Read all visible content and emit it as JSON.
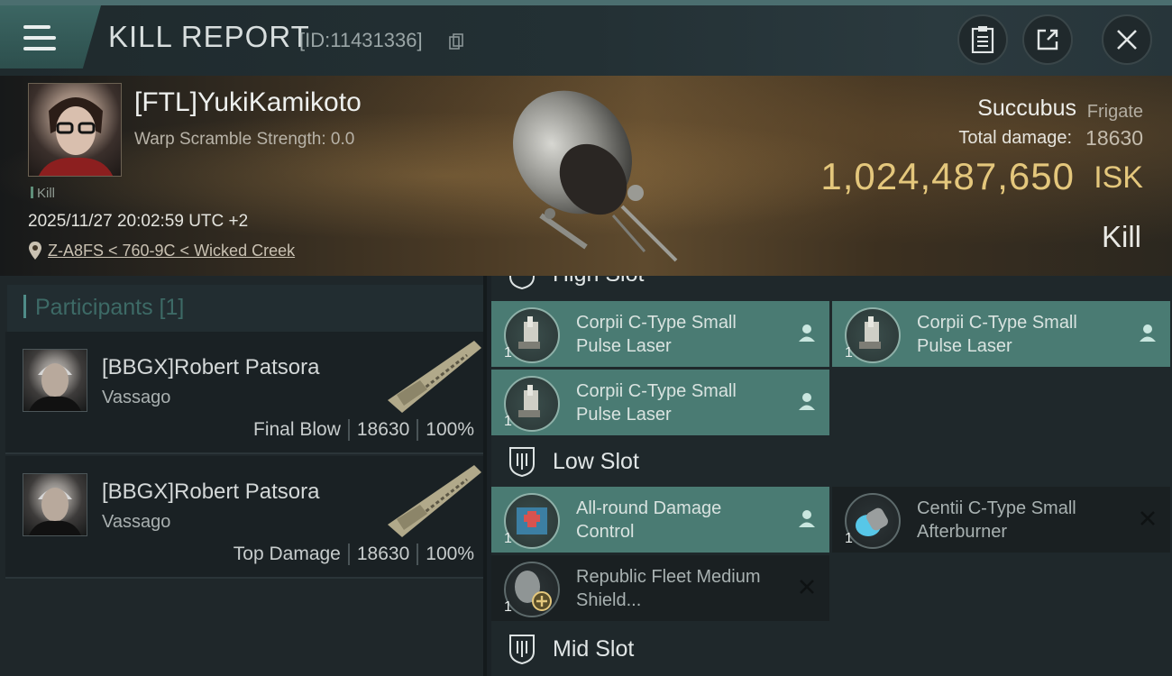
{
  "header": {
    "title": "KILL REPORT",
    "report_id": "[ID:11431336]"
  },
  "victim": {
    "pilot_name": "[FTL]YukiKamikoto",
    "warp_scramble": "Warp Scramble Strength: 0.0",
    "tag": "Kill",
    "datetime": "2025/11/27 20:02:59 UTC +2",
    "location": "Z-A8FS < 760-9C < Wicked Creek",
    "ship_name": "Succubus",
    "ship_class": "Frigate",
    "total_damage_label": "Total damage:",
    "total_damage": "18630",
    "isk_value": "1,024,487,650",
    "isk_unit": "ISK",
    "result": "Kill"
  },
  "participants": {
    "title": "Participants [1]",
    "rows": [
      {
        "name": "[BBGX]Robert Patsora",
        "ship": "Vassago",
        "label": "Final Blow",
        "damage": "18630",
        "percent": "100%"
      },
      {
        "name": "[BBGX]Robert Patsora",
        "ship": "Vassago",
        "label": "Top Damage",
        "damage": "18630",
        "percent": "100%"
      }
    ]
  },
  "slots": {
    "high_label": "High Slot",
    "low_label": "Low Slot",
    "mid_label": "Mid Slot",
    "high": [
      {
        "qty": "1",
        "name": "Corpii C-Type Small Pulse Laser",
        "state": "dropped"
      },
      {
        "qty": "1",
        "name": "Corpii C-Type Small Pulse Laser",
        "state": "dropped"
      },
      {
        "qty": "1",
        "name": "Corpii C-Type Small Pulse Laser",
        "state": "dropped"
      }
    ],
    "low": [
      {
        "qty": "1",
        "name": "All-round Damage Control",
        "state": "dropped"
      },
      {
        "qty": "1",
        "name": "Centii C-Type Small Afterburner",
        "state": "destroyed"
      },
      {
        "qty": "1",
        "name": "Republic Fleet Medium Shield...",
        "state": "destroyed"
      }
    ]
  },
  "colors": {
    "accent": "#4a7b73",
    "isk_gold": "#e4c77c"
  },
  "icons": {
    "menu": "hamburger-menu-icon",
    "copy": "copy-icon",
    "clipboard": "clipboard-icon",
    "share": "share-icon",
    "close": "close-icon",
    "location": "location-pin-icon",
    "slot": "shield-slot-icon",
    "dropped": "person-icon",
    "destroyed": "x-icon"
  }
}
